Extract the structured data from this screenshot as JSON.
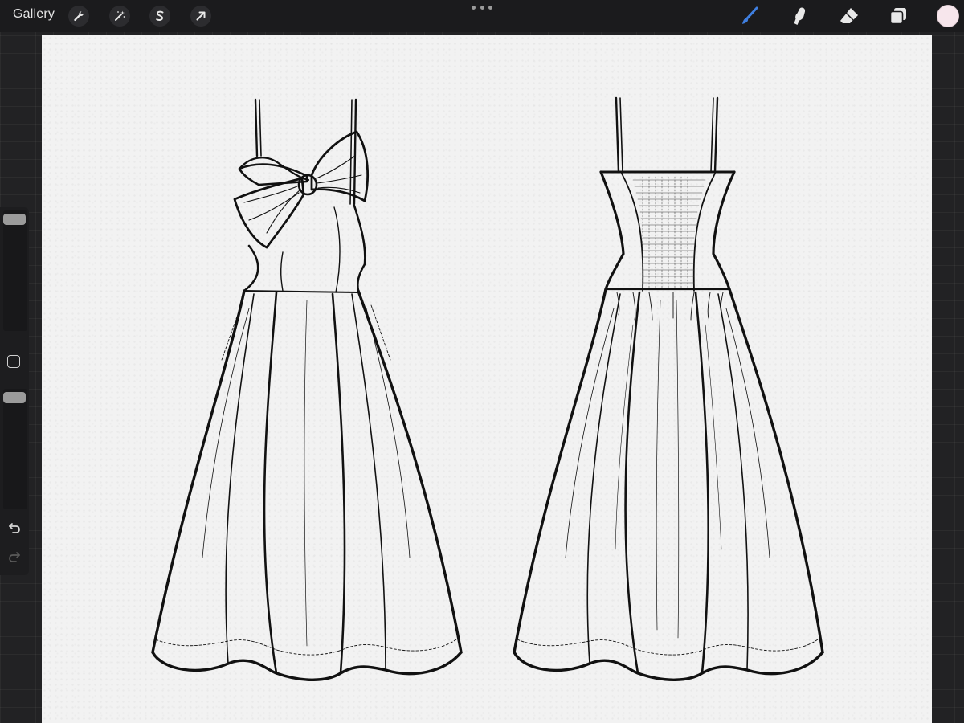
{
  "topbar": {
    "gallery_label": "Gallery",
    "left_tools": [
      {
        "name": "actions",
        "icon": "wrench-icon"
      },
      {
        "name": "adjustments",
        "icon": "magic-wand-icon"
      },
      {
        "name": "selection",
        "icon": "selection-s-icon"
      },
      {
        "name": "transform",
        "icon": "arrow-cursor-icon"
      }
    ],
    "more_menu_icon": "ellipsis-icon",
    "right_tools": [
      {
        "name": "brush",
        "icon": "brush-icon",
        "active": true
      },
      {
        "name": "smudge",
        "icon": "smudge-finger-icon",
        "active": false
      },
      {
        "name": "eraser",
        "icon": "eraser-icon",
        "active": false
      },
      {
        "name": "layers",
        "icon": "layers-icon",
        "active": false
      }
    ],
    "current_color": "#f7e6ec"
  },
  "sidebar": {
    "brush_size_level": 0.02,
    "opacity_level": 0.0,
    "modify_button_icon": "square-icon",
    "undo_icon": "undo-arrow-icon",
    "redo_icon": "redo-arrow-icon"
  },
  "colors": {
    "accent_blue": "#3f7fe0",
    "canvas_paper": "#f2f2f2",
    "ink": "#111111",
    "ui_dark": "#1b1b1d"
  },
  "artwork": {
    "front_view": "dress-front-flat-sketch",
    "back_view": "dress-back-flat-sketch"
  }
}
